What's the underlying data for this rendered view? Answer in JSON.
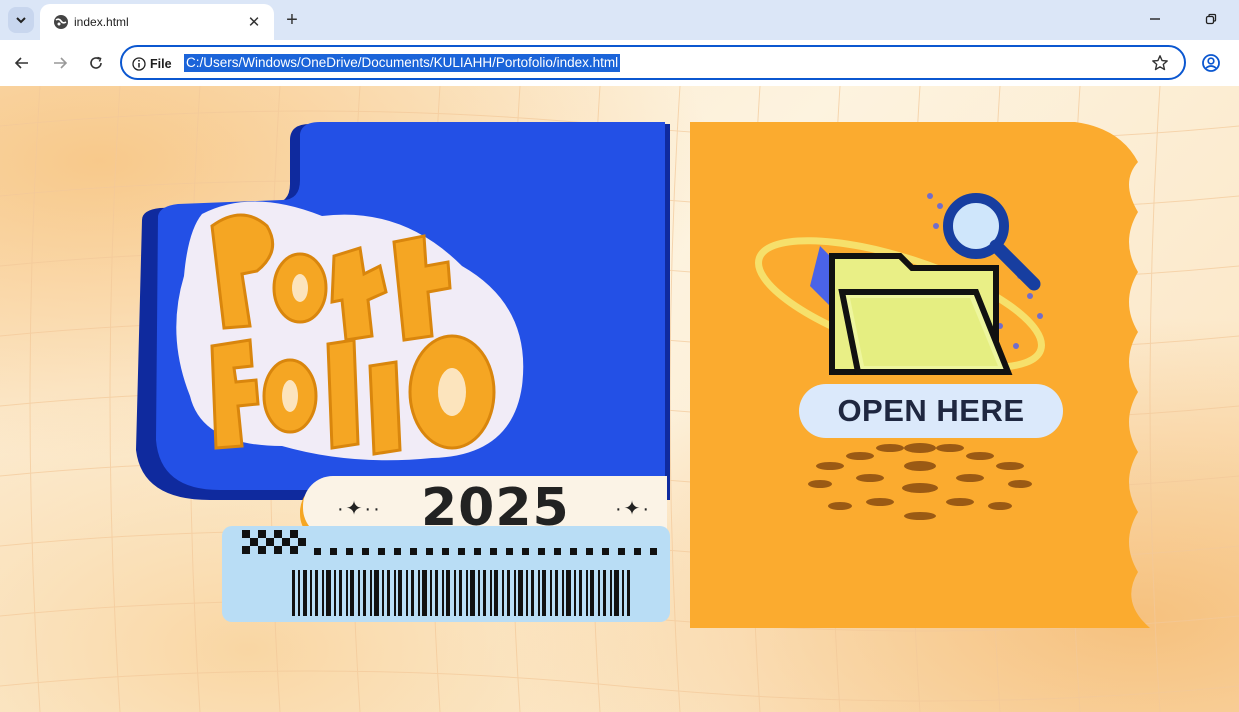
{
  "browser": {
    "tab": {
      "title": "index.html",
      "close_label": "✕"
    },
    "new_tab_label": "+",
    "omnibox": {
      "site_info_label": "File",
      "url": "C:/Users/Windows/OneDrive/Documents/KULIAHH/Portofolio/index.html"
    },
    "accent_color": "#0b57d0"
  },
  "page": {
    "cover_left": {
      "title_art_text": "Portfolio",
      "year": "2025",
      "sparkle_left": "·✦··",
      "sparkle_right": "·✦·",
      "colors": {
        "panel_blue": "#2350e6",
        "dark_blue": "#0f2a9e",
        "orange": "#f5a623",
        "ticket_blue": "#b9ddf5"
      }
    },
    "cover_right": {
      "cta_label": "OPEN HERE",
      "icons": [
        "folder-icon",
        "magnifier-icon"
      ],
      "colors": {
        "panel_orange": "#fbab2f",
        "pill": "#dbe9fb"
      }
    }
  }
}
